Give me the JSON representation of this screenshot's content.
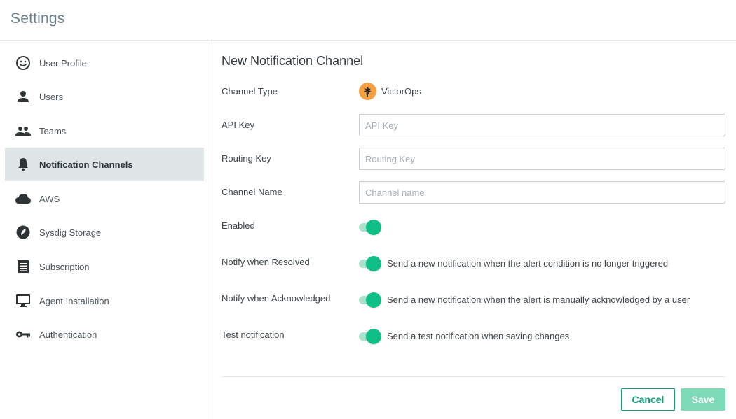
{
  "header": {
    "title": "Settings"
  },
  "sidebar": {
    "items": [
      {
        "label": "User Profile",
        "icon": "smiley-icon",
        "active": false
      },
      {
        "label": "Users",
        "icon": "person-icon",
        "active": false
      },
      {
        "label": "Teams",
        "icon": "group-icon",
        "active": false
      },
      {
        "label": "Notification Channels",
        "icon": "bell-icon",
        "active": true
      },
      {
        "label": "AWS",
        "icon": "cloud-icon",
        "active": false
      },
      {
        "label": "Sysdig Storage",
        "icon": "storage-icon",
        "active": false
      },
      {
        "label": "Subscription",
        "icon": "receipt-icon",
        "active": false
      },
      {
        "label": "Agent Installation",
        "icon": "monitor-icon",
        "active": false
      },
      {
        "label": "Authentication",
        "icon": "key-icon",
        "active": false
      }
    ]
  },
  "form": {
    "title": "New Notification Channel",
    "channel_type": {
      "label": "Channel Type",
      "value": "VictorOps",
      "icon": "victorops-logo-icon"
    },
    "api_key": {
      "label": "API Key",
      "value": "",
      "placeholder": "API Key"
    },
    "routing_key": {
      "label": "Routing Key",
      "value": "",
      "placeholder": "Routing Key"
    },
    "channel_name": {
      "label": "Channel Name",
      "value": "",
      "placeholder": "Channel name"
    },
    "enabled": {
      "label": "Enabled",
      "on": true
    },
    "notify_resolved": {
      "label": "Notify when Resolved",
      "on": true,
      "description": "Send a new notification when the alert condition is no longer triggered"
    },
    "notify_ack": {
      "label": "Notify when Acknowledged",
      "on": true,
      "description": "Send a new notification when the alert is manually acknowledged by a user"
    },
    "test_notification": {
      "label": "Test notification",
      "on": true,
      "description": "Send a test notification when saving changes"
    }
  },
  "actions": {
    "cancel_label": "Cancel",
    "save_label": "Save"
  },
  "colors": {
    "accent": "#10bf85",
    "accent_light": "#a9e3cb",
    "active_nav_bg": "#dfe5e6",
    "save_disabled": "#7ddbb7",
    "victorops_orange": "#f5a142"
  }
}
